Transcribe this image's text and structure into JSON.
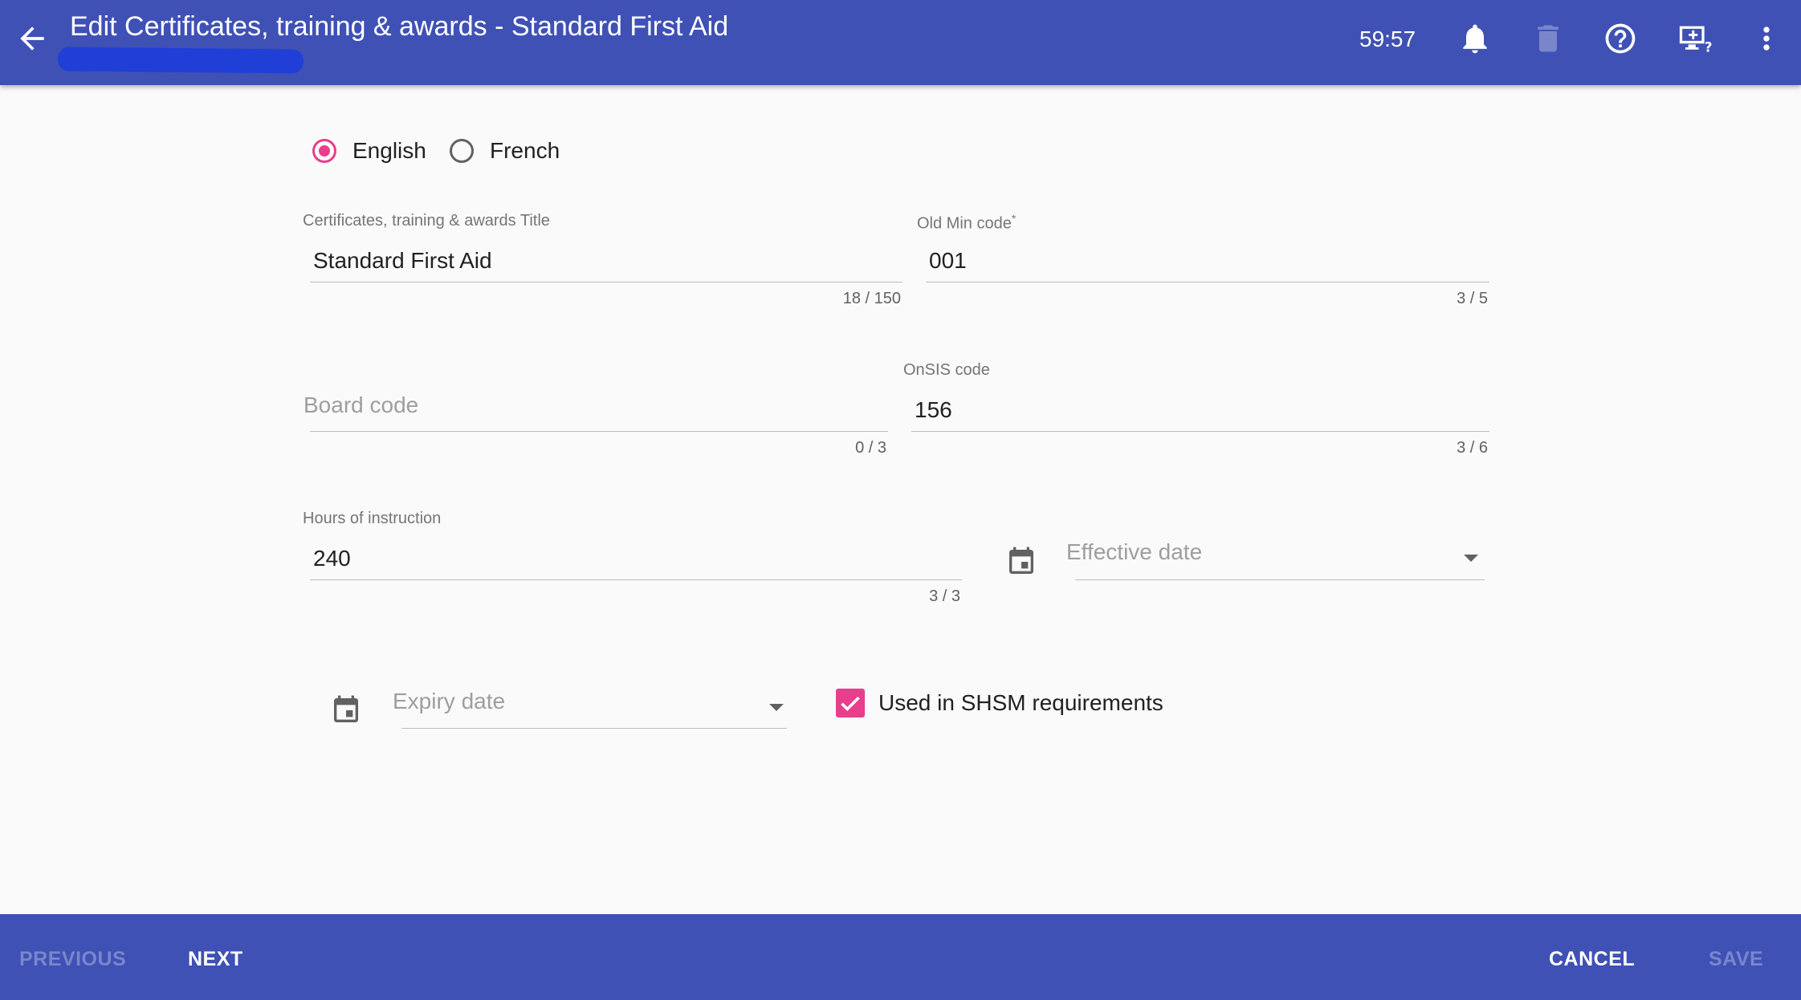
{
  "header": {
    "title": "Edit Certificates, training & awards - Standard First Aid",
    "timer": "59:57",
    "icons": [
      "arrow-back-icon",
      "bell-icon",
      "trash-icon",
      "help-icon",
      "screen-share-icon",
      "more-vert-icon"
    ]
  },
  "language": {
    "options": [
      {
        "label": "English",
        "selected": true
      },
      {
        "label": "French",
        "selected": false
      }
    ]
  },
  "form": {
    "title_field": {
      "label": "Certificates, training & awards Title",
      "value": "Standard First Aid",
      "counter": "18 / 150"
    },
    "old_min_code": {
      "label": "Old Min code",
      "required_mark": "*",
      "value": "001",
      "counter": "3 / 5"
    },
    "board_code": {
      "placeholder": "Board code",
      "value": "",
      "counter": "0 / 3"
    },
    "onsis_code": {
      "label": "OnSIS code",
      "value": "156",
      "counter": "3 / 6"
    },
    "hours": {
      "label": "Hours of instruction",
      "value": "240",
      "counter": "3 / 3"
    },
    "effective_date": {
      "placeholder": "Effective date",
      "value": ""
    },
    "expiry_date": {
      "placeholder": "Expiry date",
      "value": ""
    },
    "shsm": {
      "label": "Used in SHSM requirements",
      "checked": true
    }
  },
  "footer": {
    "previous": "PREVIOUS",
    "next": "NEXT",
    "cancel": "CANCEL",
    "save": "SAVE"
  },
  "colors": {
    "primary": "#3f51b5",
    "accent": "#e83e8c",
    "disabled_text": "#7986cb"
  }
}
